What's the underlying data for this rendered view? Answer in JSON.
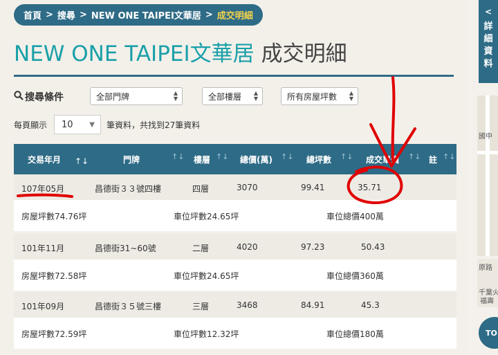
{
  "breadcrumb": {
    "home": "首頁",
    "search": "搜尋",
    "building": "NEW ONE TAIPEI文華居",
    "current": "成交明細",
    "separator": ">"
  },
  "title": {
    "building": "NEW ONE TAIPEI文華居",
    "page": "成交明細"
  },
  "filters": {
    "label": "搜尋條件",
    "door": "全部門牌",
    "floor": "全部樓層",
    "area": "所有房屋坪數"
  },
  "pagination": {
    "per_page_label": "每頁顯示",
    "per_page_value": "10",
    "result_text": "筆資料，共找到27筆資料"
  },
  "table": {
    "headers": [
      "交易年月",
      "門牌",
      "樓層",
      "總價(萬)",
      "總坪數",
      "成交單價",
      "註"
    ],
    "rows": [
      {
        "date": "107年05月",
        "address": "昌德街３３號四樓",
        "floor": "四層",
        "total": "3070",
        "area": "99.41",
        "unit": "35.71",
        "house_area": "房屋坪數74.76坪",
        "parking_area": "車位坪數24.65坪",
        "parking_price": "車位總價400萬"
      },
      {
        "date": "101年11月",
        "address": "昌德街31~60號",
        "floor": "二層",
        "total": "4020",
        "area": "97.23",
        "unit": "50.43",
        "house_area": "房屋坪數72.58坪",
        "parking_area": "車位坪數24.65坪",
        "parking_price": "車位總價360萬"
      },
      {
        "date": "101年09月",
        "address": "昌德街３５號三樓",
        "floor": "三層",
        "total": "3468",
        "area": "84.91",
        "unit": "45.3",
        "house_area": "房屋坪數72.59坪",
        "parking_area": "車位坪數12.32坪",
        "parking_price": "車位總價180萬"
      }
    ]
  },
  "sidebar": {
    "chevron": "<",
    "tab_label": "詳細資料",
    "map_labels": [
      "國中",
      "原路",
      "千葉火",
      "福壽"
    ],
    "top_button": "TO"
  },
  "colors": {
    "primary": "#2e6b86",
    "accent_teal": "#1aa0a8",
    "current_crumb": "#f5d34d",
    "annotation_red": "#e00000"
  }
}
